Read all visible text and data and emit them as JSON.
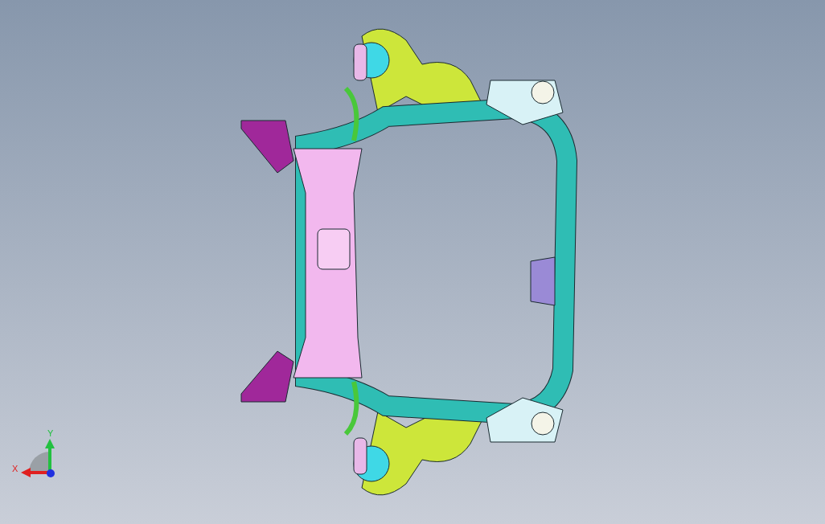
{
  "viewport": {
    "axis_triad": {
      "x_label": "X",
      "y_label": "Y"
    }
  }
}
